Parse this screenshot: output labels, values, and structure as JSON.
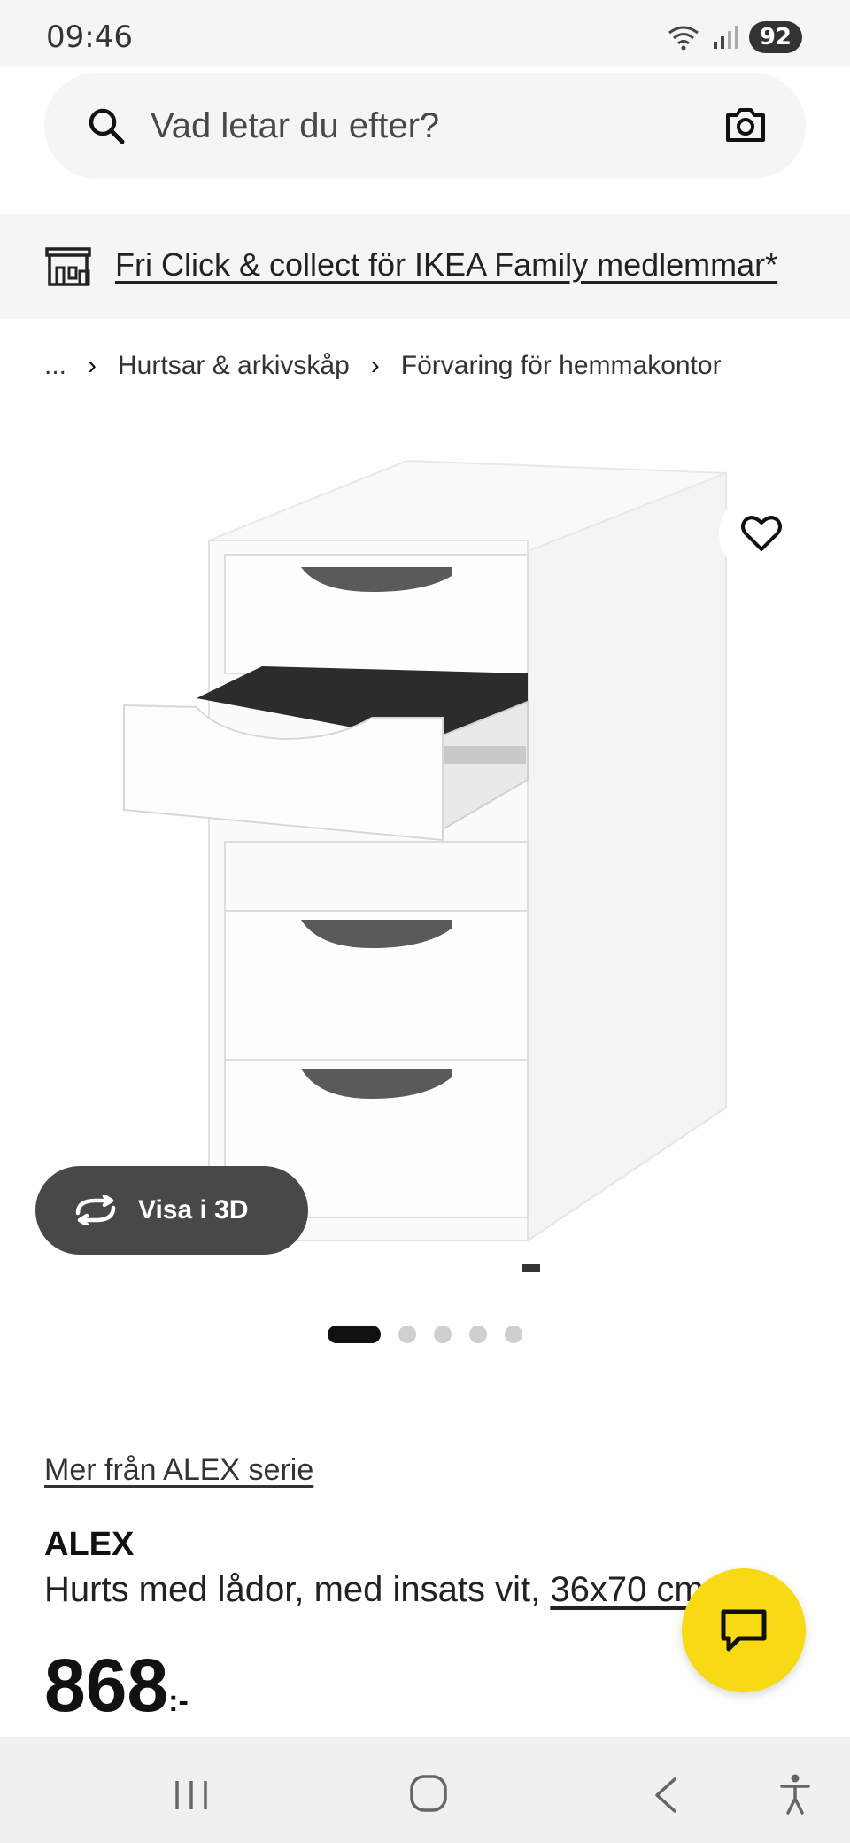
{
  "status_bar": {
    "time": "09:46",
    "battery": "92"
  },
  "search": {
    "placeholder": "Vad letar du efter?"
  },
  "promo": {
    "text": "Fri Click & collect för IKEA Family medlemmar*"
  },
  "breadcrumb": {
    "ellipsis": "...",
    "items": [
      "Hurtsar & arkivskåp",
      "Förvaring för hemmakontor"
    ]
  },
  "viewer": {
    "view_3d_label": "Visa i 3D",
    "image_count": 5,
    "active_image": 1
  },
  "product": {
    "series_link": "Mer från ALEX serie",
    "name": "ALEX",
    "description": "Hurts med lådor, med insats vit, ",
    "size_link": "36x70 cm",
    "price_integer": "868",
    "price_suffix": ":-"
  },
  "colors": {
    "accent": "#f7d914",
    "dark": "#484848",
    "surface": "#f5f5f5"
  },
  "icons": [
    "search-icon",
    "camera-icon",
    "store-icon",
    "heart-icon",
    "rotate-3d-icon",
    "chat-icon"
  ]
}
